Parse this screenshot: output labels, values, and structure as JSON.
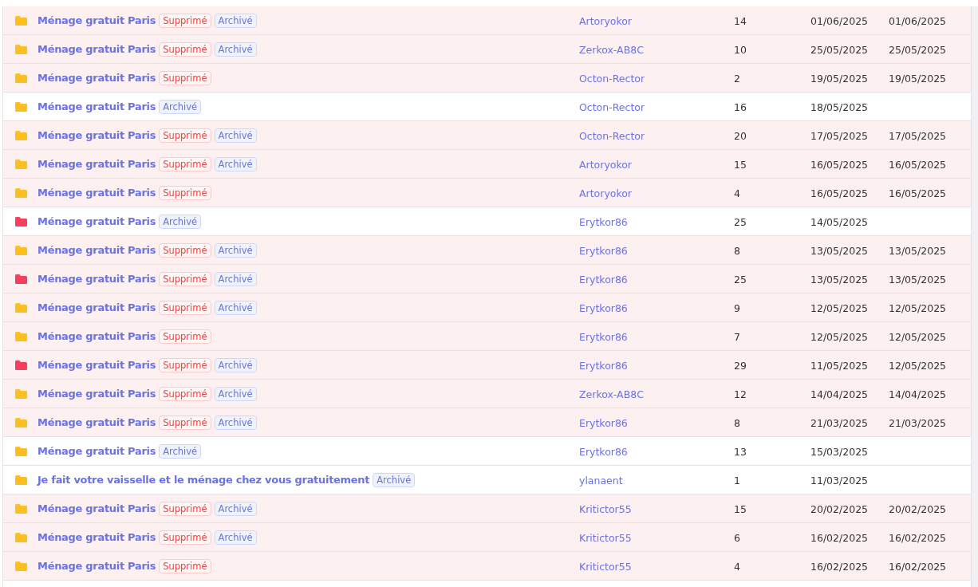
{
  "rows": [
    {
      "color": "#fbbf24",
      "title": "Ménage gratuit Paris",
      "badges": [
        {
          "kind": "deleted",
          "label": "Supprimé"
        },
        {
          "kind": "archived",
          "label": "Archivé"
        }
      ],
      "author": "Artoryokor",
      "count": "14",
      "date_1": "01/06/2025",
      "date_2": "01/06/2025"
    },
    {
      "color": "#fbbf24",
      "title": "Ménage gratuit Paris",
      "badges": [
        {
          "kind": "deleted",
          "label": "Supprimé"
        },
        {
          "kind": "archived",
          "label": "Archivé"
        }
      ],
      "author": "Zerkox-AB8C",
      "count": "10",
      "date_1": "25/05/2025",
      "date_2": "25/05/2025"
    },
    {
      "color": "#fbbf24",
      "title": "Ménage gratuit Paris",
      "badges": [
        {
          "kind": "deleted",
          "label": "Supprimé"
        }
      ],
      "author": "Octon-Rector",
      "count": "2",
      "date_1": "19/05/2025",
      "date_2": "19/05/2025"
    },
    {
      "color": "#fbbf24",
      "title": "Ménage gratuit Paris",
      "badges": [
        {
          "kind": "archived",
          "label": "Archivé"
        }
      ],
      "author": "Octon-Rector",
      "count": "16",
      "date_1": "18/05/2025"
    },
    {
      "color": "#fbbf24",
      "title": "Ménage gratuit Paris",
      "badges": [
        {
          "kind": "deleted",
          "label": "Supprimé"
        },
        {
          "kind": "archived",
          "label": "Archivé"
        }
      ],
      "author": "Octon-Rector",
      "count": "20",
      "date_1": "17/05/2025",
      "date_2": "17/05/2025"
    },
    {
      "color": "#fbbf24",
      "title": "Ménage gratuit Paris",
      "badges": [
        {
          "kind": "deleted",
          "label": "Supprimé"
        },
        {
          "kind": "archived",
          "label": "Archivé"
        }
      ],
      "author": "Artoryokor",
      "count": "15",
      "date_1": "16/05/2025",
      "date_2": "16/05/2025"
    },
    {
      "color": "#fbbf24",
      "title": "Ménage gratuit Paris",
      "badges": [
        {
          "kind": "deleted",
          "label": "Supprimé"
        }
      ],
      "author": "Artoryokor",
      "count": "4",
      "date_1": "16/05/2025",
      "date_2": "16/05/2025"
    },
    {
      "color": "#f43f5e",
      "title": "Ménage gratuit Paris",
      "badges": [
        {
          "kind": "archived",
          "label": "Archivé"
        }
      ],
      "author": "Erytkor86",
      "count": "25",
      "date_1": "14/05/2025"
    },
    {
      "color": "#fbbf24",
      "title": "Ménage gratuit Paris",
      "badges": [
        {
          "kind": "deleted",
          "label": "Supprimé"
        },
        {
          "kind": "archived",
          "label": "Archivé"
        }
      ],
      "author": "Erytkor86",
      "count": "8",
      "date_1": "13/05/2025",
      "date_2": "13/05/2025"
    },
    {
      "color": "#f43f5e",
      "title": "Ménage gratuit Paris",
      "badges": [
        {
          "kind": "deleted",
          "label": "Supprimé"
        },
        {
          "kind": "archived",
          "label": "Archivé"
        }
      ],
      "author": "Erytkor86",
      "count": "25",
      "date_1": "13/05/2025",
      "date_2": "13/05/2025"
    },
    {
      "color": "#fbbf24",
      "title": "Ménage gratuit Paris",
      "badges": [
        {
          "kind": "deleted",
          "label": "Supprimé"
        },
        {
          "kind": "archived",
          "label": "Archivé"
        }
      ],
      "author": "Erytkor86",
      "count": "9",
      "date_1": "12/05/2025",
      "date_2": "12/05/2025"
    },
    {
      "color": "#fbbf24",
      "title": "Ménage gratuit Paris",
      "badges": [
        {
          "kind": "deleted",
          "label": "Supprimé"
        }
      ],
      "author": "Erytkor86",
      "count": "7",
      "date_1": "12/05/2025",
      "date_2": "12/05/2025"
    },
    {
      "color": "#f43f5e",
      "title": "Ménage gratuit Paris",
      "badges": [
        {
          "kind": "deleted",
          "label": "Supprimé"
        },
        {
          "kind": "archived",
          "label": "Archivé"
        }
      ],
      "author": "Erytkor86",
      "count": "29",
      "date_1": "11/05/2025",
      "date_2": "12/05/2025"
    },
    {
      "color": "#fbbf24",
      "title": "Ménage gratuit Paris",
      "badges": [
        {
          "kind": "deleted",
          "label": "Supprimé"
        },
        {
          "kind": "archived",
          "label": "Archivé"
        }
      ],
      "author": "Zerkox-AB8C",
      "count": "12",
      "date_1": "14/04/2025",
      "date_2": "14/04/2025"
    },
    {
      "color": "#fbbf24",
      "title": "Ménage gratuit Paris",
      "badges": [
        {
          "kind": "deleted",
          "label": "Supprimé"
        },
        {
          "kind": "archived",
          "label": "Archivé"
        }
      ],
      "author": "Erytkor86",
      "count": "8",
      "date_1": "21/03/2025",
      "date_2": "21/03/2025"
    },
    {
      "color": "#fbbf24",
      "title": "Ménage gratuit Paris",
      "badges": [
        {
          "kind": "archived",
          "label": "Archivé"
        }
      ],
      "author": "Erytkor86",
      "count": "13",
      "date_1": "15/03/2025"
    },
    {
      "color": "#fbbf24",
      "title": "Je fait votre vaisselle et le ménage chez vous gratuitement",
      "badges": [
        {
          "kind": "archived",
          "label": "Archivé"
        }
      ],
      "author": "ylanaent",
      "count": "1",
      "date_1": "11/03/2025"
    },
    {
      "color": "#fbbf24",
      "title": "Ménage gratuit Paris",
      "badges": [
        {
          "kind": "deleted",
          "label": "Supprimé"
        },
        {
          "kind": "archived",
          "label": "Archivé"
        }
      ],
      "author": "Kritictor55",
      "count": "15",
      "date_1": "20/02/2025",
      "date_2": "20/02/2025"
    },
    {
      "color": "#fbbf24",
      "title": "Ménage gratuit Paris",
      "badges": [
        {
          "kind": "deleted",
          "label": "Supprimé"
        },
        {
          "kind": "archived",
          "label": "Archivé"
        }
      ],
      "author": "Kritictor55",
      "count": "6",
      "date_1": "16/02/2025",
      "date_2": "16/02/2025"
    },
    {
      "color": "#fbbf24",
      "title": "Ménage gratuit Paris",
      "badges": [
        {
          "kind": "deleted",
          "label": "Supprimé"
        }
      ],
      "author": "Kritictor55",
      "count": "4",
      "date_1": "16/02/2025",
      "date_2": "16/02/2025"
    }
  ]
}
